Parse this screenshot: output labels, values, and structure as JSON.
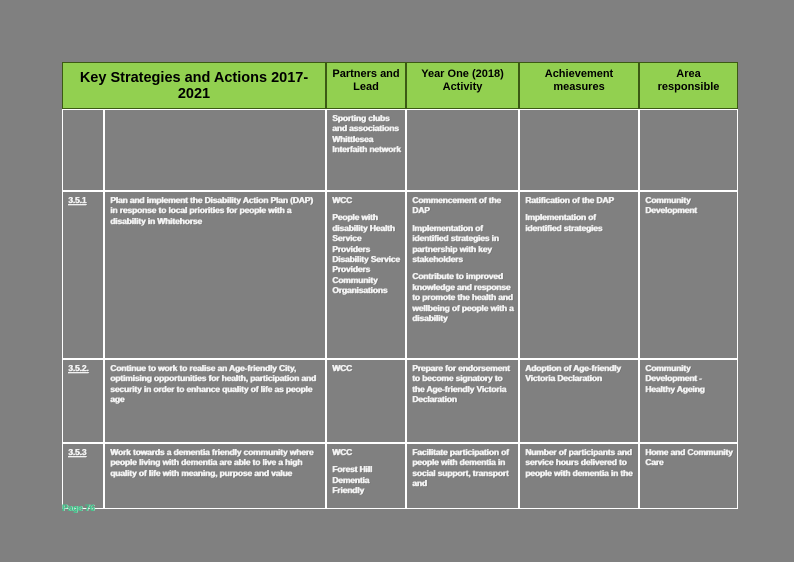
{
  "document": {
    "page_label": "Page 76"
  },
  "table": {
    "headers": {
      "num": "",
      "action": "Key Strategies and Actions 2017-2021",
      "partner": "Partners and Lead",
      "year_one": "Year One (2018) Activity",
      "measure": "Achievement measures",
      "area": "Area responsible"
    },
    "rows": [
      {
        "num": "",
        "action": "",
        "partner": "Sporting clubs and associations Whittlesea Interfaith network",
        "year_one": "",
        "measure": "",
        "area": ""
      },
      {
        "num": "3.5.1",
        "action": "Plan and implement the Disability Action Plan (DAP) in response to local priorities for people with a disability in Whitehorse",
        "partner": "WCC",
        "partner_extra": "People with disability Health Service Providers Disability Service Providers Community Organisations",
        "year_one_p1": "Commencement of the DAP",
        "year_one_p2": "Implementation of identified strategies in partnership with key stakeholders",
        "year_one_p3": "Contribute to improved knowledge and response to promote the health and wellbeing of people with a disability",
        "measure_p1": "Ratification of the DAP",
        "measure_p2": "Implementation of identified strategies",
        "area": "Community Development"
      },
      {
        "num": "3.5.2.",
        "action": "Continue to work to realise an Age-friendly City, optimising opportunities for health, participation and security in order to enhance quality of life as people age",
        "partner": "WCC",
        "year_one": "Prepare for endorsement to become signatory to the Age-friendly Victoria Declaration",
        "measure": "Adoption of Age-friendly Victoria Declaration",
        "area": "Community Development - Healthy Ageing"
      },
      {
        "num": "3.5.3",
        "action": "Work towards a dementia friendly community where people living with dementia are able to live a high quality of life with meaning, purpose and value",
        "partner": "WCC",
        "partner_extra": "Forest Hill Dementia Friendly",
        "year_one": "Facilitate participation of people with dementia in social support, transport and",
        "measure": "Number of participants and service hours delivered to people with dementia in the",
        "area": "Home and Community Care"
      }
    ]
  }
}
